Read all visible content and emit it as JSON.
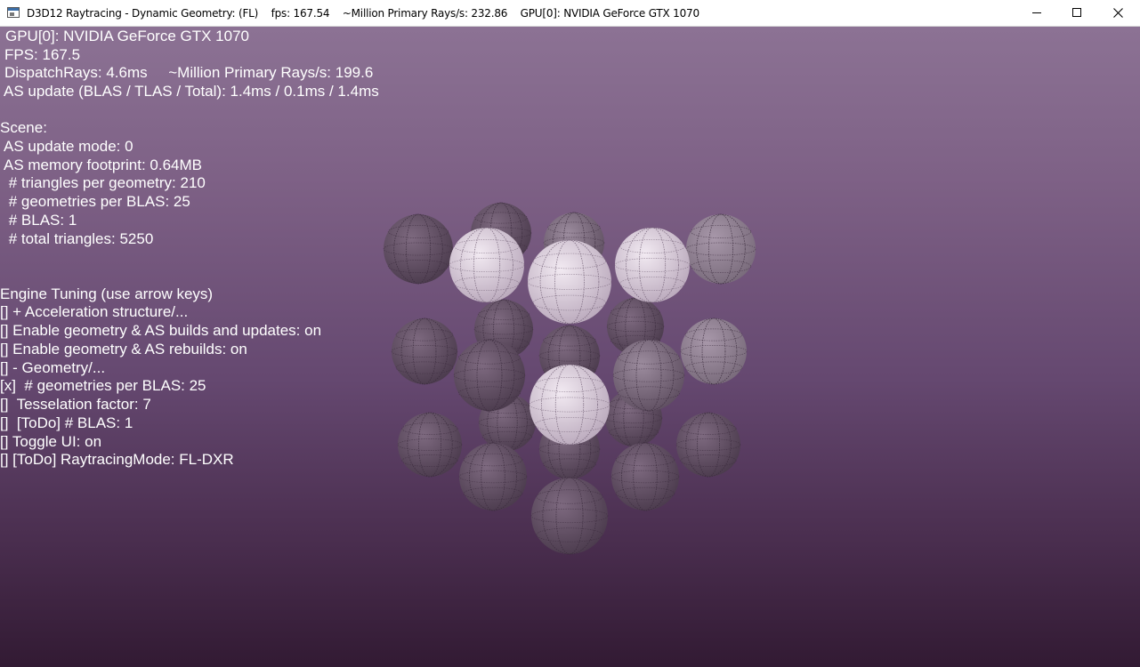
{
  "window": {
    "title": "D3D12 Raytracing - Dynamic Geometry: (FL)    fps: 167.54    ~Million Primary Rays/s: 232.86    GPU[0]: NVIDIA GeForce GTX 1070",
    "minimize_icon": "minimize-icon",
    "maximize_icon": "maximize-icon",
    "close_icon": "close-icon"
  },
  "overlay": {
    "stats": [
      "GPU[0]: NVIDIA GeForce GTX 1070",
      "FPS: 167.5",
      "DispatchRays: 4.6ms     ~Million Primary Rays/s: 199.6",
      "AS update (BLAS / TLAS / Total): 1.4ms / 0.1ms / 1.4ms"
    ],
    "scene_header": "Scene:",
    "scene": [
      "AS update mode: 0",
      "AS memory footprint: 0.64MB",
      " # triangles per geometry: 210",
      " # geometries per BLAS: 25",
      " # BLAS: 1",
      " # total triangles: 5250"
    ],
    "tuning_header": "Engine Tuning (use arrow keys)",
    "tuning": [
      "[] + Acceleration structure/...",
      "[] Enable geometry & AS builds and updates: on",
      "[] Enable geometry & AS rebuilds: on",
      "[] - Geometry/...",
      "[x]  # geometries per BLAS: 25",
      "[]  Tesselation factor: 7",
      "[]  [ToDo] # BLAS: 1",
      "[] Toggle UI: on",
      "[] [ToDo] RaytracingMode: FL-DXR"
    ]
  },
  "colors": {
    "background_top": "#8c7294",
    "background_bottom": "#321a33",
    "text": "#ffffff"
  }
}
